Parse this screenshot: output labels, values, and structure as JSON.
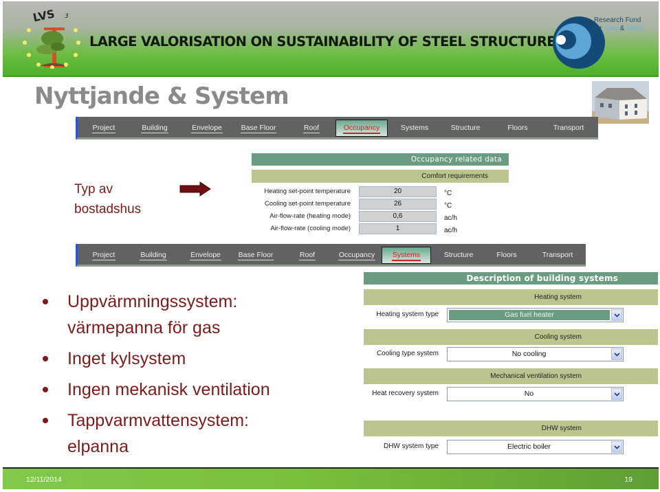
{
  "banner": {
    "logo_text": "LVS",
    "logo_superscript": "3",
    "title": "LARGE VALORISATION ON SUSTAINABILITY OF STEEL STRUCTURES",
    "fund_line1": "Research Fund",
    "fund_line2_prefix": "for ",
    "fund_coal": "Coal",
    "fund_amp": " & ",
    "fund_steel": "Steel"
  },
  "slide": {
    "title": "Nyttjande & System",
    "photo_icon": "house-photo"
  },
  "nav_top": {
    "tabs": [
      {
        "label": "Project"
      },
      {
        "label": "Building"
      },
      {
        "label": "Envelope"
      },
      {
        "label": "Base Floor"
      },
      {
        "label": "Roof"
      },
      {
        "label": "Occupancy",
        "active": true
      },
      {
        "label": "Systems"
      },
      {
        "label": "Structure"
      },
      {
        "label": "Floors"
      },
      {
        "label": "Transport"
      }
    ]
  },
  "occupancy": {
    "section_title": "Occupancy related data",
    "subsection_title": "Comfort requirements",
    "rows": [
      {
        "label": "Heating set-point temperature",
        "value": "20",
        "unit": "°C"
      },
      {
        "label": "Cooling set-point temperature",
        "value": "26",
        "unit": "°C"
      },
      {
        "label": "Air-flow-rate (heating mode)",
        "value": "0,6",
        "unit": "ac/h"
      },
      {
        "label": "Air-flow-rate (cooling mode)",
        "value": "1",
        "unit": "ac/h"
      }
    ]
  },
  "annotation": {
    "line1": "Typ av",
    "line2": "bostadshus",
    "arrow_icon": "right-arrow"
  },
  "nav_bottom": {
    "tabs": [
      {
        "label": "Project"
      },
      {
        "label": "Building"
      },
      {
        "label": "Envelope"
      },
      {
        "label": "Base Floor"
      },
      {
        "label": "Roof"
      },
      {
        "label": "Occupancy"
      },
      {
        "label": "Systems",
        "active": true
      },
      {
        "label": "Structure"
      },
      {
        "label": "Floors"
      },
      {
        "label": "Transport"
      }
    ]
  },
  "systems": {
    "section_title": "Description of building systems",
    "groups": [
      {
        "title": "Heating system",
        "field_label": "Heating system type",
        "value": "Gas fuel heater",
        "highlighted": true
      },
      {
        "title": "Cooling system",
        "field_label": "Cooling type system",
        "value": "No cooling"
      },
      {
        "title": "Mechanical ventilation system",
        "field_label": "Heat recovery system",
        "value": "No"
      },
      {
        "title": "DHW system",
        "field_label": "DHW system type",
        "value": "Electric boiler"
      }
    ]
  },
  "bullets": [
    "Uppvärmningssystem:\nvärmepanna för gas",
    "Inget kylsystem",
    "Ingen mekanisk ventilation",
    "Tappvarmvattensystem:\nelpanna"
  ],
  "footer": {
    "date": "12/11/2014",
    "page": "19"
  },
  "colors": {
    "accent_text": "#7a1c1c",
    "panel_green": "#6a9c82",
    "panel_olive": "#bdc58f",
    "tab_active_text": "#d12222",
    "banner_green": "#4cb02a"
  }
}
